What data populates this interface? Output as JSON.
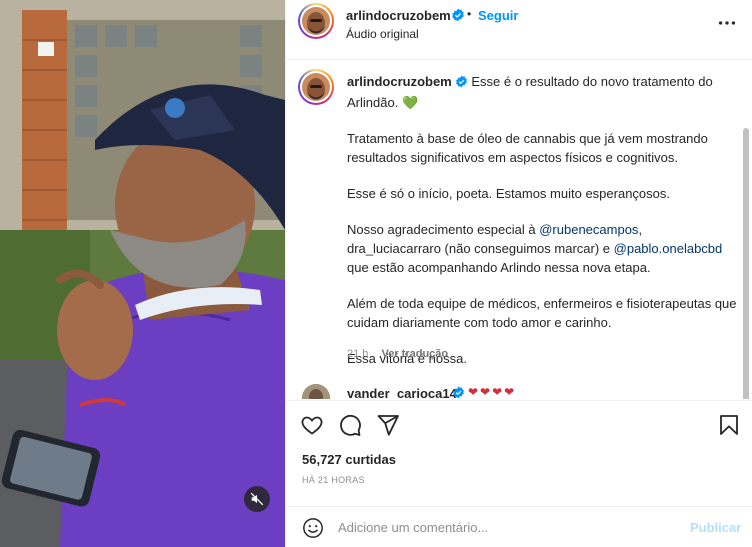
{
  "post": {
    "username": "arlindocruzobem",
    "separator": "•",
    "follow_label": "Seguir",
    "audio_label": "Áudio original"
  },
  "caption": {
    "username": "arlindocruzobem",
    "p1_text": "Esse é o resultado do novo tratamento do Arlindão.",
    "p1_emoji": "💚",
    "p2": "Tratamento à base de óleo de cannabis que já vem mostrando resultados significativos em aspectos físicos e cognitivos.",
    "p3": "Esse é só o início, poeta. Estamos muito esperançosos.",
    "p4_pre": "Nosso agradecimento especial à",
    "p4_mention1": "@rubenecampos",
    "p4_mid": ", dra_luciacarraro (não conseguimos marcar) e",
    "p4_mention2": "@pablo.onelabcbd",
    "p4_post": "que estão acompanhando Arlindo nessa nova etapa.",
    "p5": "Além de toda equipe de médicos, enfermeiros e fisioterapeutas que cuidam diariamente com todo amor e carinho.",
    "p6": "Essa vitória é nossa.",
    "time_ago": "21 h",
    "see_translation": "Ver tradução"
  },
  "comment": {
    "username": "vander_carioca14",
    "text": "❤❤❤❤"
  },
  "stats": {
    "likes": "56,727 curtidas",
    "time": "HÁ 21 HORAS"
  },
  "compose": {
    "placeholder": "Adicione um comentário...",
    "publish_label": "Publicar"
  },
  "icons": {
    "like": "heart-icon",
    "comment": "comment-icon",
    "share": "send-icon",
    "save": "bookmark-icon",
    "more": "more-icon",
    "emoji": "emoji-icon",
    "mute": "muted-speaker-icon",
    "verified": "verified-badge-icon"
  },
  "colors": {
    "link": "#0095f6",
    "mention": "#00376b",
    "verified": "#0095f6",
    "heart_green": "#2ecc71",
    "publish_disabled": "#b2dffc"
  }
}
